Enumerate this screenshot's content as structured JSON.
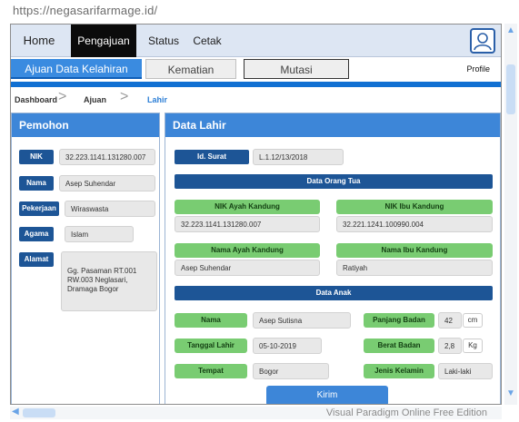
{
  "url": "https://negasarifarmage.id/",
  "nav": {
    "home": "Home",
    "active": "Pengajuan",
    "status": "Status",
    "cetak": "Cetak",
    "user_icon": "user-avatar-icon"
  },
  "tabs": {
    "t1": "Ajuan Data Kelahiran",
    "t2": "Kematian",
    "t3": "Mutasi",
    "profile": "Profile"
  },
  "breadcrumb": {
    "c1": "Dashboard",
    "c2": "Ajuan",
    "c3": "Lahir",
    "sep": ">"
  },
  "pemohon": {
    "title": "Pemohon",
    "nik_label": "NIK",
    "nik": "32.223.1141.131280.007",
    "nama_label": "Nama",
    "nama": "Asep Suhendar",
    "pekerjaan_label": "Pekerjaan",
    "pekerjaan": "Wiraswasta",
    "agama_label": "Agama",
    "agama": "Islam",
    "alamat_label": "Alamat",
    "alamat": "Gg. Pasaman  RT.001 RW.003 Neglasari, Dramaga Bogor"
  },
  "lahir": {
    "title": "Data Lahir",
    "id_surat_label": "Id. Surat",
    "id_surat": "L.1.12/13/2018",
    "ortu_head": "Data Orang Tua",
    "nik_ayah_label": "NIK Ayah Kandung",
    "nik_ayah": "32.223.1141.131280.007",
    "nik_ibu_label": "NIK Ibu Kandung",
    "nik_ibu": "32.221.1241.100990.004",
    "nama_ayah_label": "Nama Ayah Kandung",
    "nama_ayah": "Asep Suhendar",
    "nama_ibu_label": "Nama Ibu Kandung",
    "nama_ibu": "Ratiyah",
    "anak_head": "Data Anak",
    "nama_label": "Nama",
    "nama": "Asep Sutisna",
    "panjang_label": "Panjang Badan",
    "panjang": "42",
    "panjang_unit": "cm",
    "tgl_label": "Tanggal Lahir",
    "tgl": "05-10-2019",
    "berat_label": "Berat Badan",
    "berat": "2,8",
    "berat_unit": "Kg",
    "tempat_label": "Tempat",
    "tempat": "Bogor",
    "jk_label": "Jenis Kelamin",
    "jk": "Laki-laki",
    "kirim": "Kirim"
  },
  "footer": {
    "watermark": "Visual Paradigm Online Free Edition"
  }
}
